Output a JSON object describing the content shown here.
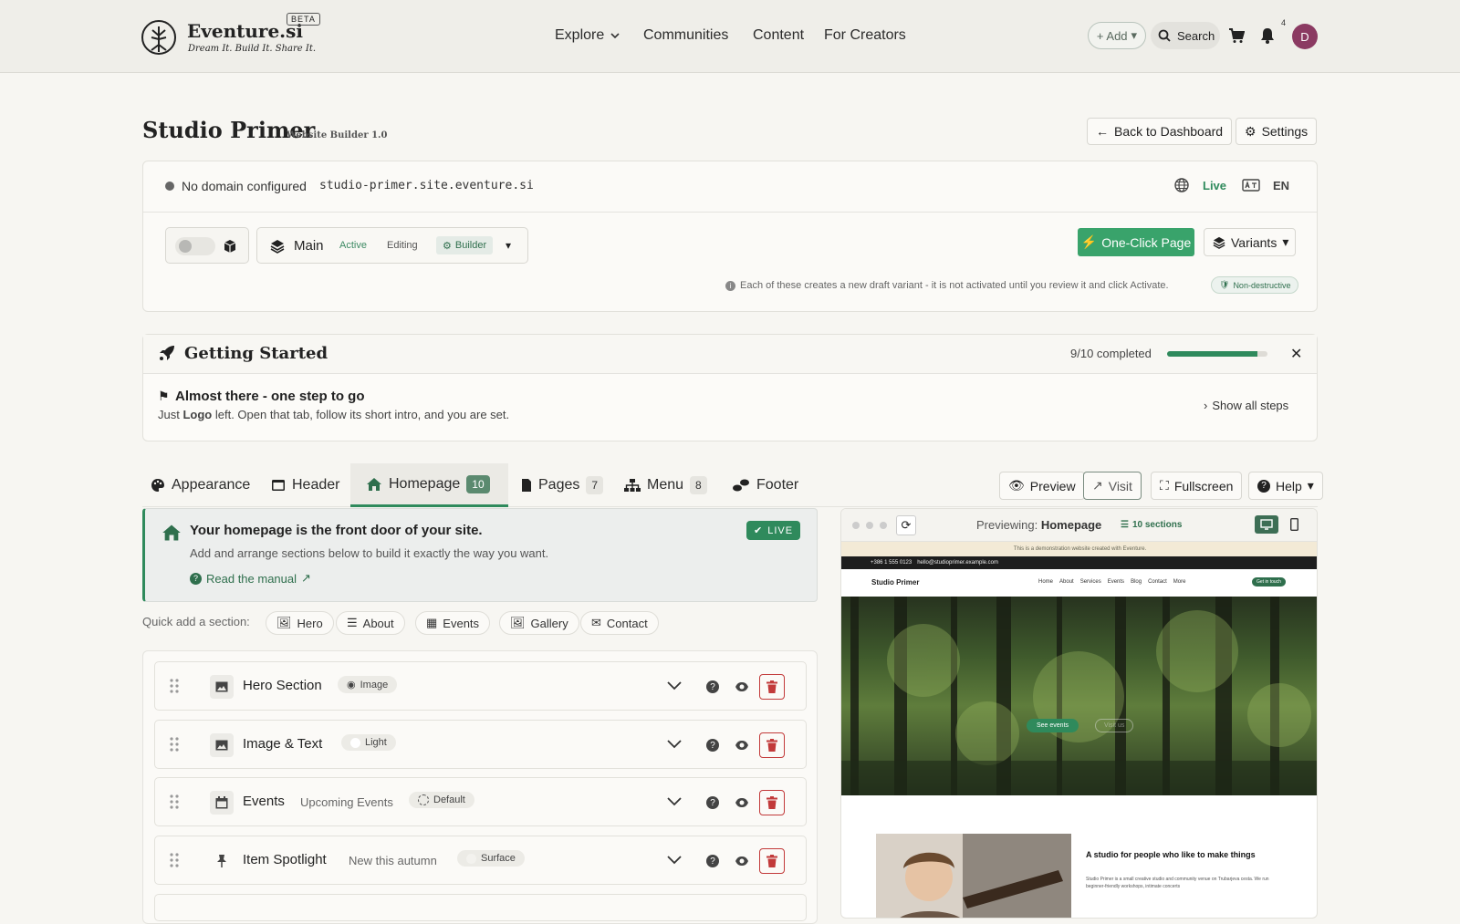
{
  "brand": {
    "name": "Eventure.si",
    "tagline": "Dream It. Build It. Share It.",
    "beta": "BETA"
  },
  "nav": {
    "links": [
      "Explore",
      "Communities",
      "Content",
      "For Creators"
    ],
    "add": "+ Add",
    "search": "Search",
    "notif_count": "4",
    "avatar": "D"
  },
  "page": {
    "title": "Studio Primer",
    "subtitle": "Website Builder 1.0",
    "back": "Back to Dashboard",
    "settings": "Settings"
  },
  "domain": {
    "status": "No domain configured",
    "url": "studio-primer.site.eventure.si",
    "live": "Live",
    "lang": "EN"
  },
  "variant": {
    "name": "Main",
    "active": "Active",
    "editing": "Editing",
    "builder": "Builder",
    "oneclick": "One-Click Page",
    "variants": "Variants",
    "note": "Each of these creates a new draft variant - it is not activated until you review it and click Activate.",
    "nondestructive": "Non-destructive"
  },
  "getting_started": {
    "title": "Getting Started",
    "progress_text": "9/10 completed",
    "progress": 0.9,
    "headline": "Almost there - one step to go",
    "body_pre": "Just ",
    "body_bold": "Logo",
    "body_post": " left. Open that tab, follow its short intro, and you are set.",
    "show_all": "Show all steps"
  },
  "tabs": [
    {
      "label": "Appearance"
    },
    {
      "label": "Header"
    },
    {
      "label": "Homepage",
      "count": "10"
    },
    {
      "label": "Pages",
      "count": "7"
    },
    {
      "label": "Menu",
      "count": "8"
    },
    {
      "label": "Footer"
    }
  ],
  "toolbar": {
    "preview": "Preview",
    "visit": "Visit",
    "fullscreen": "Fullscreen",
    "help": "Help"
  },
  "info": {
    "title": "Your homepage is the front door of your site.",
    "body": "Add and arrange sections below to build it exactly the way you want.",
    "manual": "Read the manual",
    "live": "LIVE"
  },
  "quickadd": {
    "label": "Quick add a section:",
    "items": [
      "Hero",
      "About",
      "Events",
      "Gallery",
      "Contact"
    ]
  },
  "sections": [
    {
      "title": "Hero Section",
      "sub": "",
      "chip": "Image"
    },
    {
      "title": "Image & Text",
      "sub": "",
      "chip": "Light"
    },
    {
      "title": "Events",
      "sub": "Upcoming Events",
      "chip": "Default"
    },
    {
      "title": "Item Spotlight",
      "sub": "New this autumn",
      "chip": "Surface"
    }
  ],
  "preview": {
    "label": "Previewing:",
    "page": "Homepage",
    "sections": "10 sections",
    "demo_note": "This is a demonstration website created with Eventure.",
    "phone": "+386 1 555 0123",
    "email": "hello@studioprimer.example.com",
    "site_name": "Studio Primer",
    "site_nav": [
      "Home",
      "About",
      "Services",
      "Events",
      "Blog",
      "Contact",
      "More"
    ],
    "cta": "Get in touch",
    "hero_btn": "See events",
    "hero_btn2": "Visit us",
    "about_title": "A studio for people who like to make things",
    "about_body": "Studio Primer is a small creative studio and community venue on Trubarjeva cesta. We run beginner-friendly workshops, intimate concerts"
  },
  "colors": {
    "green": "#2f8a5c",
    "accent": "#39a36b",
    "avatar": "#8b3a62",
    "danger": "#c23a3a"
  }
}
